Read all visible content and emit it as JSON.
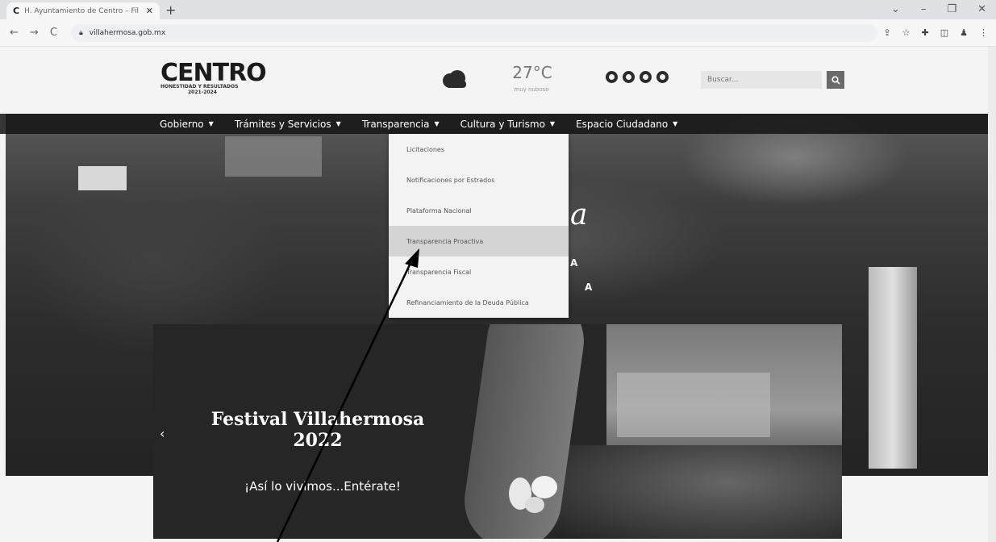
{
  "browser": {
    "tab_title": "H. Ayuntamiento de Centro – Fil",
    "tab_favicon": "C",
    "url": "villahermosa.gob.mx"
  },
  "header": {
    "logo_main": "CENTRO",
    "logo_tagline": "HONESTIDAD Y RESULTADOS",
    "logo_years": "2021-2024",
    "weather_temp": "27°C",
    "weather_desc": "muy nuboso",
    "search_placeholder": "Buscar..."
  },
  "nav": {
    "items": [
      {
        "label": "Gobierno"
      },
      {
        "label": "Trámites y Servicios"
      },
      {
        "label": "Transparencia"
      },
      {
        "label": "Cultura y Turismo"
      },
      {
        "label": "Espacio Ciudadano"
      }
    ]
  },
  "dropdown": {
    "items": [
      {
        "label": "Licitaciones"
      },
      {
        "label": "Notificaciones por Estrados"
      },
      {
        "label": "Plataforma Nacional"
      },
      {
        "label": "Transparencia Proactiva",
        "active": true
      },
      {
        "label": "Transparencia Fiscal"
      },
      {
        "label": "Refinanciamiento de la Deuda Pública"
      }
    ]
  },
  "hero": {
    "word": "a",
    "letter1": "A",
    "letter2": "A"
  },
  "slide": {
    "title_line1": "Festival Villahermosa",
    "title_line2": "2022",
    "subtitle": "¡Así lo vivimos...Entérate!"
  },
  "icons": {
    "weather": "cloud-icon",
    "social": [
      "facebook-icon",
      "twitter-icon",
      "instagram-icon",
      "youtube-icon"
    ],
    "search": "search-icon"
  }
}
